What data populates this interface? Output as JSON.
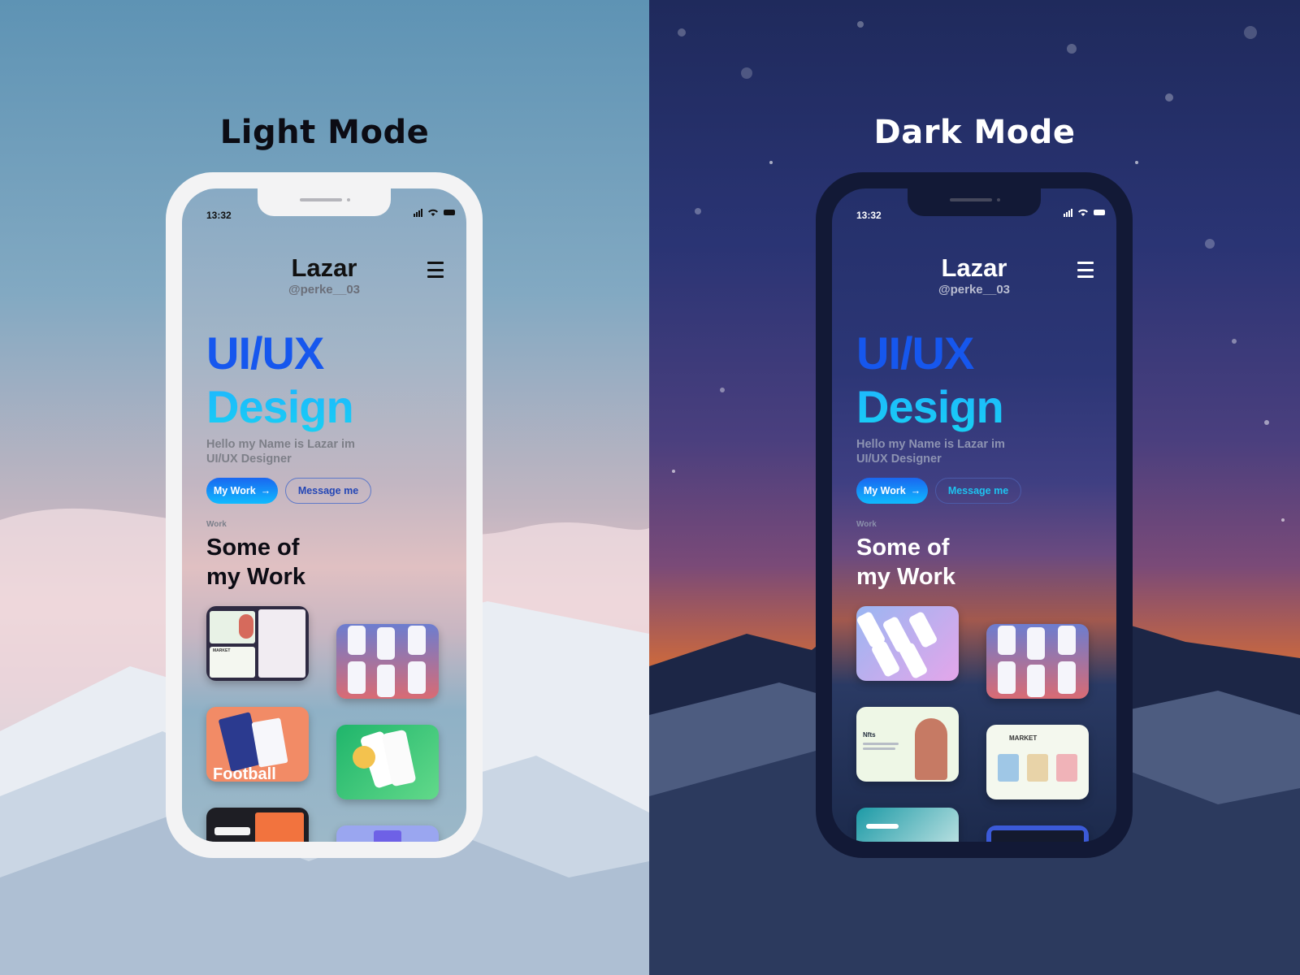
{
  "panels": {
    "light": {
      "title": "Light Mode"
    },
    "dark": {
      "title": "Dark Mode"
    }
  },
  "status_bar": {
    "time": "13:32"
  },
  "profile": {
    "name": "Lazar",
    "handle": "@perke__03"
  },
  "hero": {
    "line1": "UI/UX",
    "line2": "Design",
    "intro": "Hello my Name is Lazar im UI/UX Designer"
  },
  "actions": {
    "primary_label": "My Work",
    "primary_arrow": "→",
    "secondary_label": "Message me"
  },
  "work": {
    "eyebrow": "Work",
    "title_line1": "Some of",
    "title_line2": "my Work"
  },
  "tile_texts": {
    "market": "MARKET",
    "nfts": "Nfts",
    "football": "Football"
  },
  "icons": [
    "signal-icon",
    "wifi-icon",
    "battery-icon",
    "menu-icon",
    "arrow-right-icon"
  ],
  "colors": {
    "accent_blue": "#1657ee",
    "accent_cyan": "#17d0f3",
    "text_dark": "#0c0c14",
    "frame_light": "#f3f3f4",
    "frame_dark": "#121936"
  }
}
